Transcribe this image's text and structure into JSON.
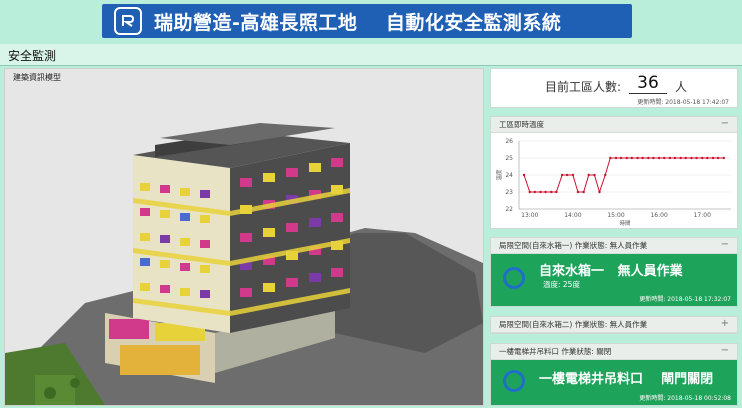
{
  "header": {
    "title": "瑞助營造-高雄長照工地    自動化安全監測系統",
    "logo_icon": "company-logo-icon"
  },
  "page": {
    "title": "安全監測"
  },
  "model_panel": {
    "title": "建築資訊模型"
  },
  "worker_count": {
    "label": "目前工區人數:",
    "value": "36",
    "unit": "人",
    "updated": "更新時間: 2018-05-18 17:42:07"
  },
  "temperature": {
    "title": "工區即時溫度",
    "toggle": "−",
    "y_label": "溫度",
    "x_label": "時間",
    "chart_data": {
      "type": "line",
      "x_ticks": [
        "13:00",
        "14:00",
        "15:00",
        "16:00",
        "17:00"
      ],
      "y_ticks": [
        22,
        23,
        24,
        25,
        26
      ],
      "ylim": [
        22,
        26
      ],
      "xlim": [
        "12:45",
        "17:40"
      ],
      "series": [
        {
          "color": "#c8102e",
          "x": [
            "12:52",
            "13:00",
            "13:07",
            "13:15",
            "13:22",
            "13:30",
            "13:37",
            "13:45",
            "13:52",
            "14:00",
            "14:07",
            "14:15",
            "14:22",
            "14:30",
            "14:37",
            "14:45",
            "14:52",
            "15:00",
            "15:07",
            "15:15",
            "15:22",
            "15:30",
            "15:37",
            "15:45",
            "15:52",
            "16:00",
            "16:07",
            "16:15",
            "16:22",
            "16:30",
            "16:37",
            "16:45",
            "16:52",
            "17:00",
            "17:07",
            "17:15",
            "17:22",
            "17:30"
          ],
          "values": [
            24,
            23,
            23,
            23,
            23,
            23,
            23,
            24,
            24,
            24,
            23,
            23,
            24,
            24,
            23,
            24,
            25,
            25,
            25,
            25,
            25,
            25,
            25,
            25,
            25,
            25,
            25,
            25,
            25,
            25,
            25,
            25,
            25,
            25,
            25,
            25,
            25,
            25
          ]
        }
      ]
    }
  },
  "tank1": {
    "head": "局限空間(自來水箱一)   作業狀態: 無人員作業",
    "toggle": "−",
    "name": "自來水箱一   無人員作業",
    "temp": "溫度: 25度",
    "updated": "更新時間: 2018-05-18 17:32:07"
  },
  "tank2": {
    "head": "局限空間(自來水箱二)   作業狀態: 無人員作業",
    "toggle": "+"
  },
  "elevator": {
    "head": "一樓電梯井吊料口   作業狀態: 關閉",
    "toggle": "−",
    "name": "一樓電梯井吊料口    閘門關閉",
    "updated": "更新時間: 2018-05-18 00:52:08"
  }
}
